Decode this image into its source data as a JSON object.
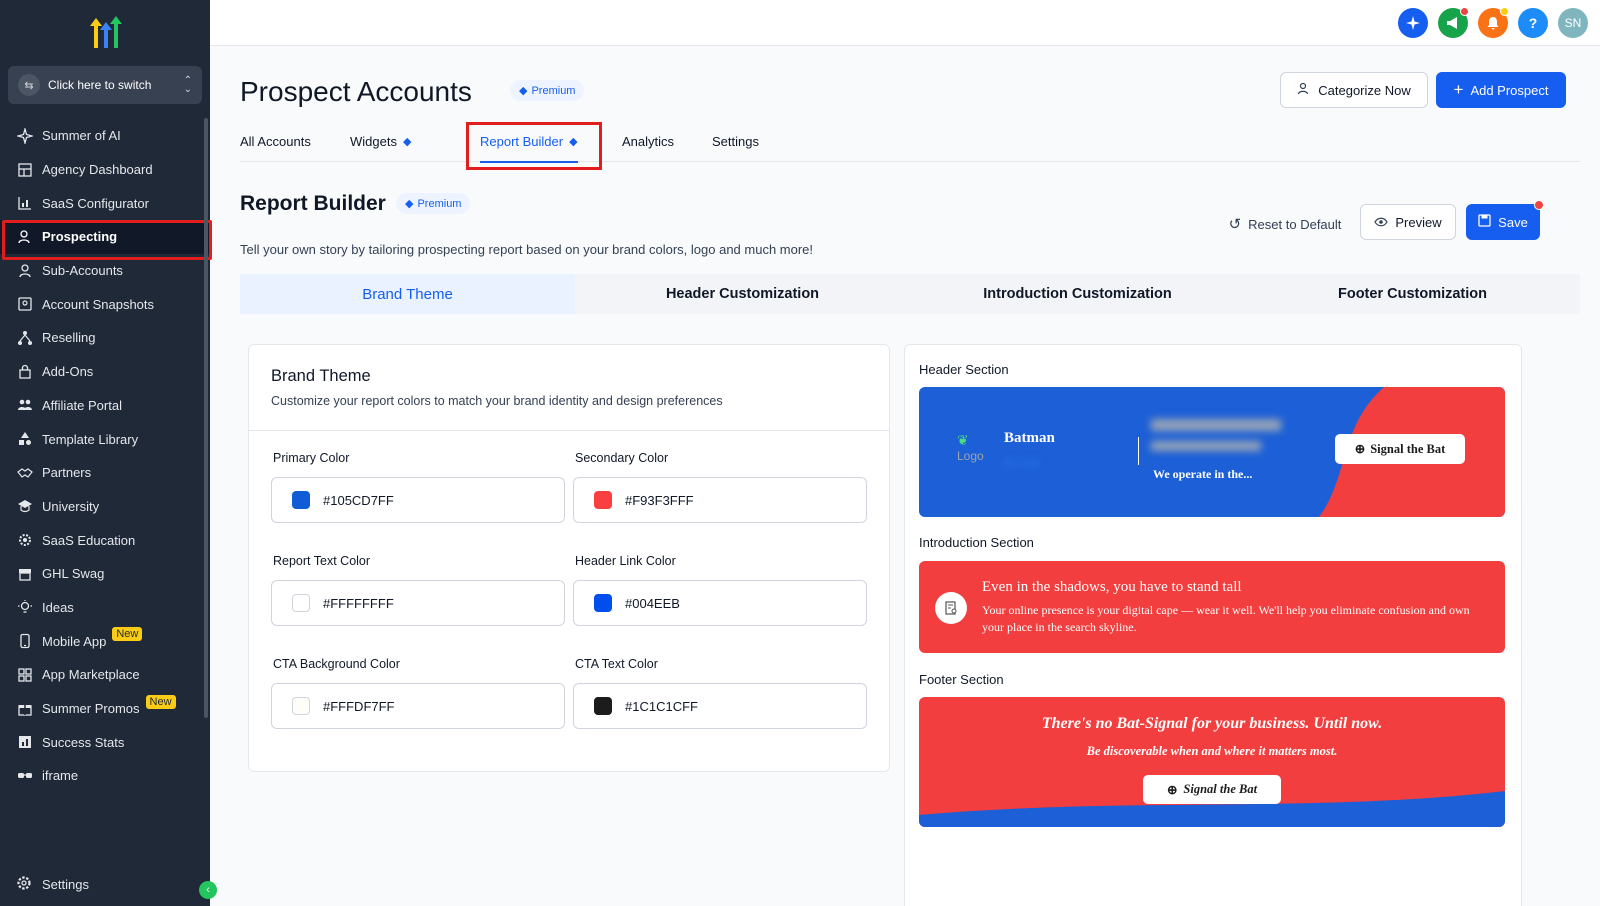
{
  "sidebar": {
    "switcher_label": "Click here to switch",
    "items": [
      {
        "label": "Summer of AI",
        "icon": "sparkle-icon"
      },
      {
        "label": "Agency Dashboard",
        "icon": "dashboard-icon"
      },
      {
        "label": "SaaS Configurator",
        "icon": "chart-icon"
      },
      {
        "label": "Prospecting",
        "icon": "user-search-icon",
        "active": true
      },
      {
        "label": "Sub-Accounts",
        "icon": "user-icon"
      },
      {
        "label": "Account Snapshots",
        "icon": "snapshot-icon"
      },
      {
        "label": "Reselling",
        "icon": "network-icon"
      },
      {
        "label": "Add-Ons",
        "icon": "bag-icon"
      },
      {
        "label": "Affiliate Portal",
        "icon": "users-icon"
      },
      {
        "label": "Template Library",
        "icon": "shapes-icon"
      },
      {
        "label": "Partners",
        "icon": "handshake-icon"
      },
      {
        "label": "University",
        "icon": "graduation-icon"
      },
      {
        "label": "SaaS Education",
        "icon": "gear-box-icon"
      },
      {
        "label": "GHL Swag",
        "icon": "store-icon"
      },
      {
        "label": "Ideas",
        "icon": "lightbulb-icon"
      },
      {
        "label": "Mobile App",
        "icon": "phone-icon",
        "badge": "New"
      },
      {
        "label": "App Marketplace",
        "icon": "grid-icon"
      },
      {
        "label": "Summer Promos",
        "icon": "gift-icon",
        "badge": "New"
      },
      {
        "label": "Success Stats",
        "icon": "stats-icon"
      },
      {
        "label": "iframe",
        "icon": "glasses-icon"
      }
    ],
    "settings_label": "Settings"
  },
  "topbar": {
    "avatar_initials": "SN",
    "help_label": "?"
  },
  "page": {
    "title": "Prospect Accounts",
    "premium_label": "Premium",
    "categorize_label": "Categorize Now",
    "add_label": "Add Prospect",
    "tabs": [
      "All Accounts",
      "Widgets",
      "Report Builder",
      "Analytics",
      "Settings"
    ],
    "active_tab": "Report Builder"
  },
  "report_builder": {
    "title": "Report Builder",
    "premium_label": "Premium",
    "description": "Tell your own story by tailoring prospecting report based on your brand colors, logo and much more!",
    "reset_label": "Reset to Default",
    "preview_label": "Preview",
    "save_label": "Save",
    "subtabs": [
      "Brand Theme",
      "Header Customization",
      "Introduction Customization",
      "Footer Customization"
    ]
  },
  "brand_theme": {
    "title": "Brand Theme",
    "subtitle": "Customize your report colors to match your brand identity and design preferences",
    "fields": [
      {
        "label": "Primary Color",
        "value": "#105CD7FF",
        "color": "#105CD7"
      },
      {
        "label": "Secondary Color",
        "value": "#F93F3FFF",
        "color": "#F93F3F"
      },
      {
        "label": "Report Text Color",
        "value": "#FFFFFFFF",
        "color": "#FFFFFF"
      },
      {
        "label": "Header Link Color",
        "value": "#004EEB",
        "color": "#004EEB"
      },
      {
        "label": "CTA Background Color",
        "value": "#FFFDF7FF",
        "color": "#FFFDF7"
      },
      {
        "label": "CTA Text Color",
        "value": "#1C1C1CFF",
        "color": "#1C1C1C"
      }
    ]
  },
  "preview": {
    "header_label": "Header Section",
    "intro_label": "Introduction Section",
    "footer_label": "Footer Section",
    "header": {
      "logo_text": "Logo",
      "brand_name": "Batman",
      "link_text": "dc.com",
      "tagline": "We operate in the...",
      "cta": "Signal the Bat"
    },
    "intro": {
      "heading": "Even in the shadows, you have to stand tall",
      "body": "Your online presence is your digital cape — wear it well. We'll help you eliminate confusion and own your place in the search skyline."
    },
    "footer": {
      "heading": "There's no Bat-Signal for your business. Until now.",
      "sub": "Be discoverable when and where it matters most.",
      "cta": "Signal the Bat"
    }
  }
}
